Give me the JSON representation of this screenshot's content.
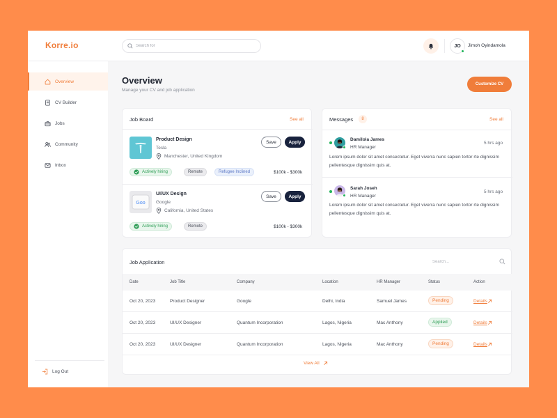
{
  "app": {
    "logo": "Korre.io"
  },
  "header": {
    "search_placeholder": "Search for",
    "user_initials": "JO",
    "user_name": "Jimoh Oyindamola"
  },
  "sidebar": {
    "items": [
      {
        "label": "Overview",
        "icon": "home-icon",
        "active": true
      },
      {
        "label": "CV Builder",
        "icon": "document-icon"
      },
      {
        "label": "Jobs",
        "icon": "briefcase-icon"
      },
      {
        "label": "Community",
        "icon": "users-icon"
      },
      {
        "label": "Inbox",
        "icon": "mail-icon"
      }
    ],
    "logout_label": "Log Out"
  },
  "page": {
    "title": "Overview",
    "subtitle": "Manage your CV and job application",
    "customize_label": "Customize CV"
  },
  "job_board": {
    "title": "Job Board",
    "see_all": "See all",
    "jobs": [
      {
        "title": "Product Design",
        "company": "Tesla",
        "location": "Manchester, United Kingdom",
        "save_label": "Save",
        "apply_label": "Apply",
        "tags": [
          "Actively hiring",
          "Remote",
          "Refugee Inclined"
        ],
        "salary": "$100k - $300k"
      },
      {
        "title": "UI/UX Design",
        "company": "Google",
        "location": "California, United States",
        "save_label": "Save",
        "apply_label": "Apply",
        "tags": [
          "Actively hiring",
          "Remote"
        ],
        "salary": "$100k - $300k"
      }
    ]
  },
  "messages": {
    "title": "Messages",
    "count": "8",
    "see_all": "See all",
    "items": [
      {
        "name": "Damilola James",
        "role": "HR Manager",
        "time": "5 hrs ago",
        "body": "Lorem ipsum dolor sit amet consectetur. Eget viverra nunc sapien tortor rte dignissim pellentesque dignissim quis at."
      },
      {
        "name": "Sarah Joseh",
        "role": "HR Manager",
        "time": "5 hrs ago",
        "body": "Lorem ipsum dolor sit amet consectetur. Eget viverra nunc sapien tortor rte dignissim pellentesque dignissim quis at."
      }
    ]
  },
  "applications": {
    "title": "Job Application",
    "search_placeholder": "Search...",
    "columns": [
      "Date",
      "Job Title",
      "Company",
      "Location",
      "HR Manager",
      "Status",
      "Action"
    ],
    "rows": [
      {
        "date": "Oct 20, 2023",
        "job": "Product Designer",
        "company": "Google",
        "location": "Delhi, India",
        "manager": "Samuel James",
        "status": "Pending",
        "action": "Details"
      },
      {
        "date": "Oct 20, 2023",
        "job": "UI/UX Designer",
        "company": "Quantum Incorporation",
        "location": "Lagos, Nigeria",
        "manager": "Mac Anthony",
        "status": "Applied",
        "action": "Details"
      },
      {
        "date": "Oct 20, 2023",
        "job": "UI/UX Designer",
        "company": "Quantum Incorporation",
        "location": "Lagos, Nigeria",
        "manager": "Mac Anthony",
        "status": "Pending",
        "action": "Details"
      }
    ],
    "view_all": "View All"
  },
  "colors": {
    "accent": "#F07D3A",
    "background": "#FF8C4B",
    "apply_button": "#18223d",
    "success": "#2f9e57"
  }
}
